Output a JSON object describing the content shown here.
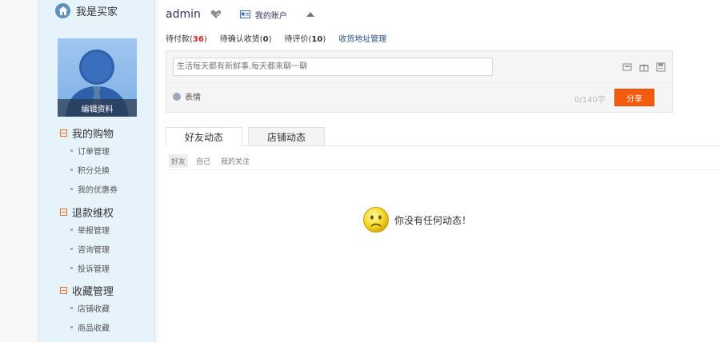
{
  "sidebar": {
    "title": "我是买家",
    "edit_profile": "编辑资料",
    "groups": [
      {
        "title": "我的购物",
        "items": [
          "订单管理",
          "积分兑换",
          "我的优惠券"
        ]
      },
      {
        "title": "退款维权",
        "items": [
          "举报管理",
          "咨询管理",
          "投诉管理"
        ]
      },
      {
        "title": "收藏管理",
        "items": [
          "店铺收藏",
          "商品收藏"
        ]
      }
    ]
  },
  "header": {
    "username": "admin",
    "account_label": "我的账户"
  },
  "status": {
    "pending_pay_label": "待付款",
    "pending_pay_count": "36",
    "pending_receive_label": "待确认收货",
    "pending_receive_count": "0",
    "pending_review_label": "待评价",
    "pending_review_count": "10",
    "address_label": "收货地址管理"
  },
  "share": {
    "placeholder": "生活每天都有新鲜事,每天都来聊一聊",
    "emoji_label": "表情",
    "counter": "0/140字",
    "button_label": "分享"
  },
  "tabs": [
    "好友动态",
    "店铺动态"
  ],
  "subtabs": [
    "好友",
    "自己",
    "我的关注"
  ],
  "empty_message": "你没有任何动态！",
  "colors": {
    "accent": "#f45b0f",
    "count_red": "#d42424",
    "sidebar_bg": "#e6f3fb"
  }
}
